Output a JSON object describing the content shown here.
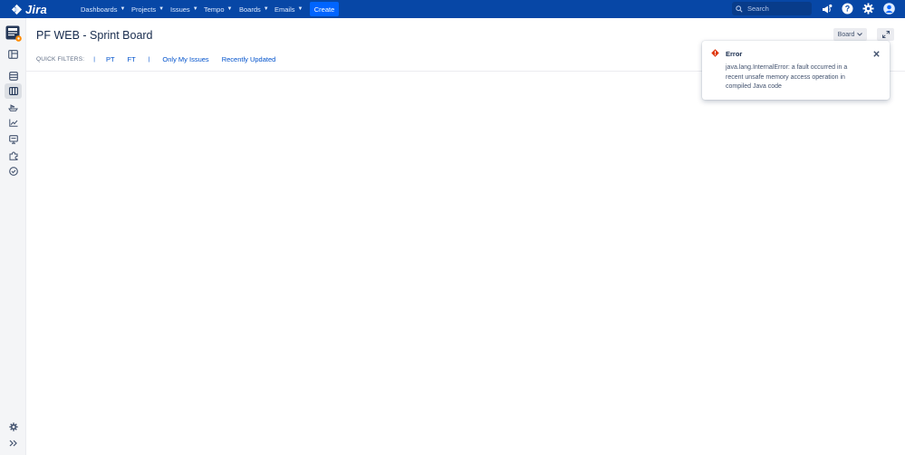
{
  "app": {
    "name": "Jira"
  },
  "nav": {
    "items": [
      {
        "label": "Dashboards"
      },
      {
        "label": "Projects"
      },
      {
        "label": "Issues"
      },
      {
        "label": "Tempo"
      },
      {
        "label": "Boards"
      },
      {
        "label": "Emails"
      }
    ],
    "create_label": "Create",
    "search_placeholder": "Search"
  },
  "page": {
    "title": "PF WEB - Sprint Board"
  },
  "quick_filters": {
    "label": "QUICK FILTERS:",
    "items": [
      "PT",
      "FT",
      "Only My Issues",
      "Recently Updated"
    ],
    "separator": "|"
  },
  "toolbar": {
    "board_label": "Board"
  },
  "error_flag": {
    "title": "Error",
    "message": "java.lang.InternalError: a fault occurred in a recent unsafe memory access operation in compiled Java code"
  },
  "colors": {
    "nav_bg": "#0747a6",
    "create_btn": "#0065ff",
    "link": "#0052cc",
    "error": "#de350b",
    "sidebar_bg": "#f4f5f7"
  }
}
